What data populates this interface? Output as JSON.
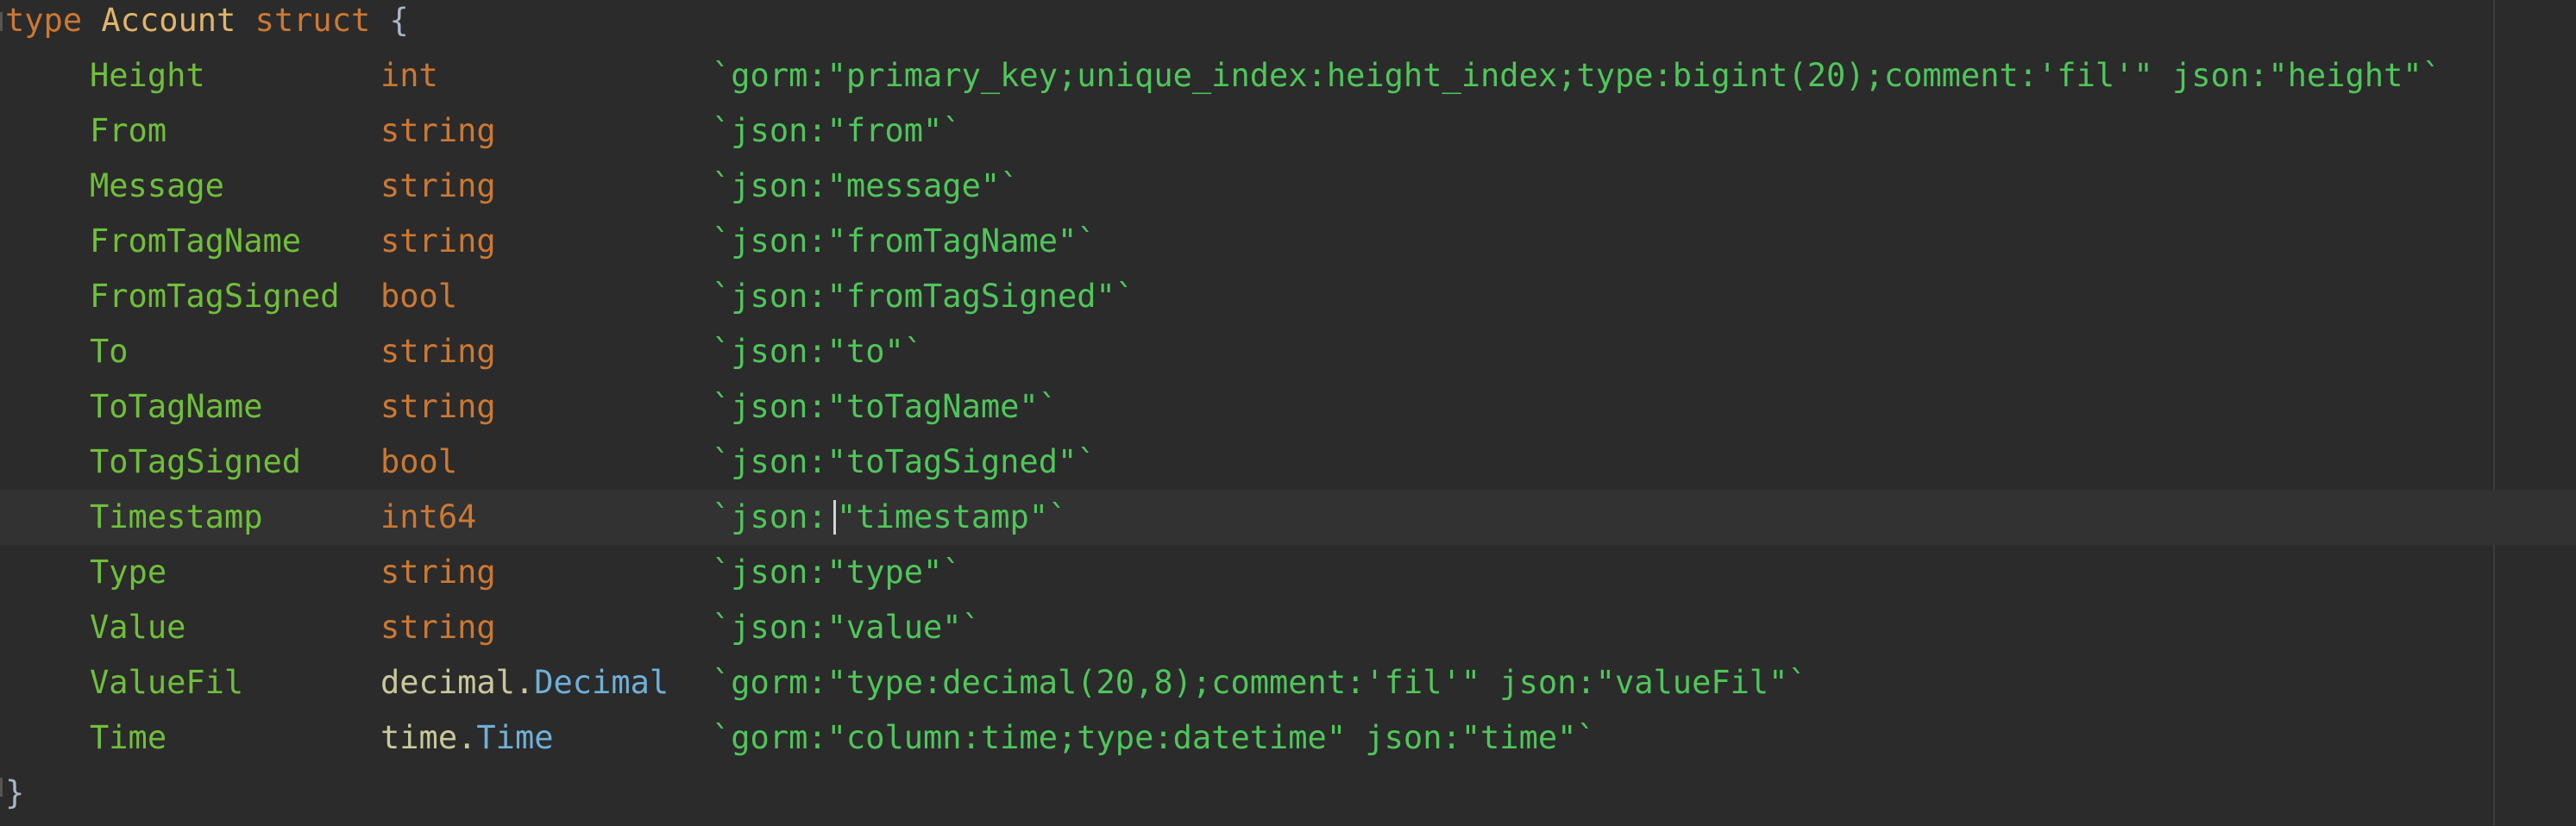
{
  "editor": {
    "header": {
      "keyword": "type",
      "name": "Account",
      "struct_kw": "struct",
      "brace_open": "{"
    },
    "footer": {
      "brace_close": "}"
    },
    "fields": [
      {
        "name": "Height",
        "type": "int",
        "tag": "`gorm:\"primary_key;unique_index:height_index;type:bigint(20);comment:'fil'\" json:\"height\"`"
      },
      {
        "name": "From",
        "type": "string",
        "tag": "`json:\"from\"`"
      },
      {
        "name": "Message",
        "type": "string",
        "tag": "`json:\"message\"`"
      },
      {
        "name": "FromTagName",
        "type": "string",
        "tag": "`json:\"fromTagName\"`"
      },
      {
        "name": "FromTagSigned",
        "type": "bool",
        "tag": "`json:\"fromTagSigned\"`"
      },
      {
        "name": "To",
        "type": "string",
        "tag": "`json:\"to\"`"
      },
      {
        "name": "ToTagName",
        "type": "string",
        "tag": "`json:\"toTagName\"`"
      },
      {
        "name": "ToTagSigned",
        "type": "bool",
        "tag": "`json:\"toTagSigned\"`"
      },
      {
        "name": "Timestamp",
        "type": "int64",
        "tag_open": "`json:",
        "tag_rest": "\"timestamp\"`"
      },
      {
        "name": "Type",
        "type": "string",
        "tag": "`json:\"type\"`"
      },
      {
        "name": "Value",
        "type": "string",
        "tag": "`json:\"value\"`"
      },
      {
        "name": "ValueFil",
        "type_pkg": "decimal.",
        "type_name": "Decimal",
        "tag": "`gorm:\"type:decimal(20,8);comment:'fil'\" json:\"valueFil\"`"
      },
      {
        "name": "Time",
        "type_pkg": "time.",
        "type_name": "Time",
        "tag": "`gorm:\"column:time;type:datetime\" json:\"time\"`"
      }
    ]
  },
  "colors": {
    "background": "#2b2b2b",
    "current_line": "#323232",
    "keyword": "#cc7832",
    "field": "#6fbf3a",
    "tag_string": "#4fc65a",
    "type_ref": "#6fb0d8"
  }
}
